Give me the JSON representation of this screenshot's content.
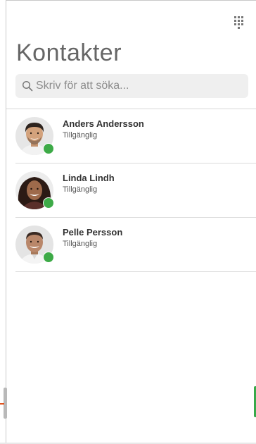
{
  "page": {
    "title": "Kontakter"
  },
  "toolbar": {
    "dialpad_icon": "dialpad-icon"
  },
  "search": {
    "placeholder": "Skriv för att söka...",
    "value": "",
    "icon": "search-icon"
  },
  "contacts": [
    {
      "name": "Anders Andersson",
      "status": "Tillgänglig",
      "presence": "available"
    },
    {
      "name": "Linda Lindh",
      "status": "Tillgänglig",
      "presence": "available"
    },
    {
      "name": "Pelle Persson",
      "status": "Tillgänglig",
      "presence": "available"
    }
  ],
  "colors": {
    "presence_available": "#3daa47",
    "title": "#666666",
    "search_bg": "#efefef",
    "divider": "#dcdcdc"
  }
}
